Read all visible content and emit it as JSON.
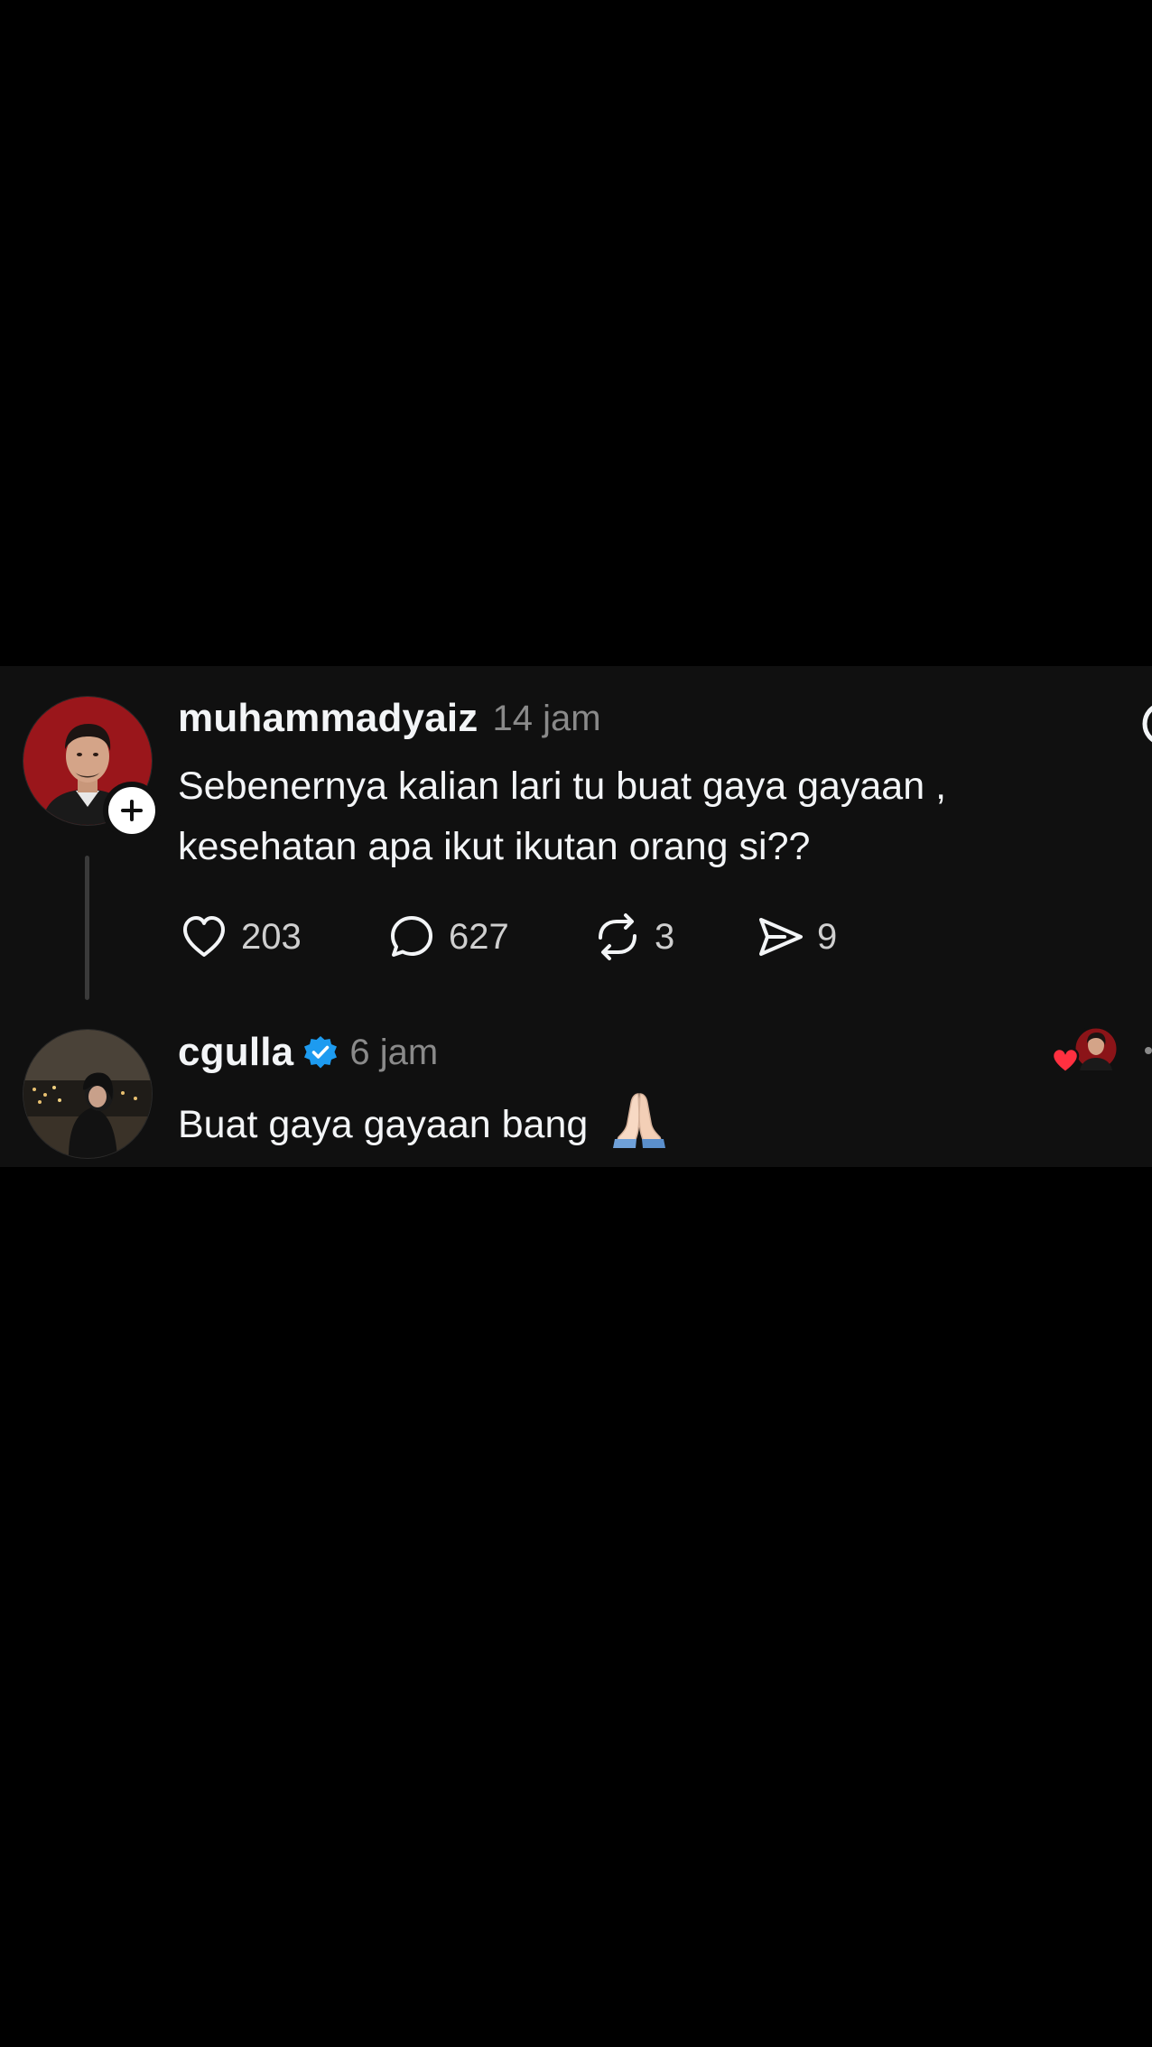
{
  "colors": {
    "background": "#000000",
    "card": "#101010",
    "text_primary": "#f3f5f7",
    "text_secondary": "#8a8a8a",
    "verified_blue": "#1d9bf0",
    "like_red": "#ff3040"
  },
  "post": {
    "username": "muhammadyaiz",
    "time": "14 jam",
    "text_line1": "Sebenernya kalian lari tu buat gaya gayaan ,",
    "text_line2": "kesehatan apa ikut ikutan orang si??",
    "avatar_icon": "profile-photo",
    "follow_icon": "plus-icon",
    "actions": {
      "like": {
        "icon": "heart-icon",
        "count": "203"
      },
      "reply": {
        "icon": "comment-icon",
        "count": "627"
      },
      "repost": {
        "icon": "repost-icon",
        "count": "3"
      },
      "share": {
        "icon": "send-icon",
        "count": "9"
      }
    }
  },
  "reply": {
    "username": "cgulla",
    "verified": true,
    "time": "6 jam",
    "text": "Buat gaya gayaan bang",
    "emoji": "folded-hands",
    "liked_by_author": true
  }
}
